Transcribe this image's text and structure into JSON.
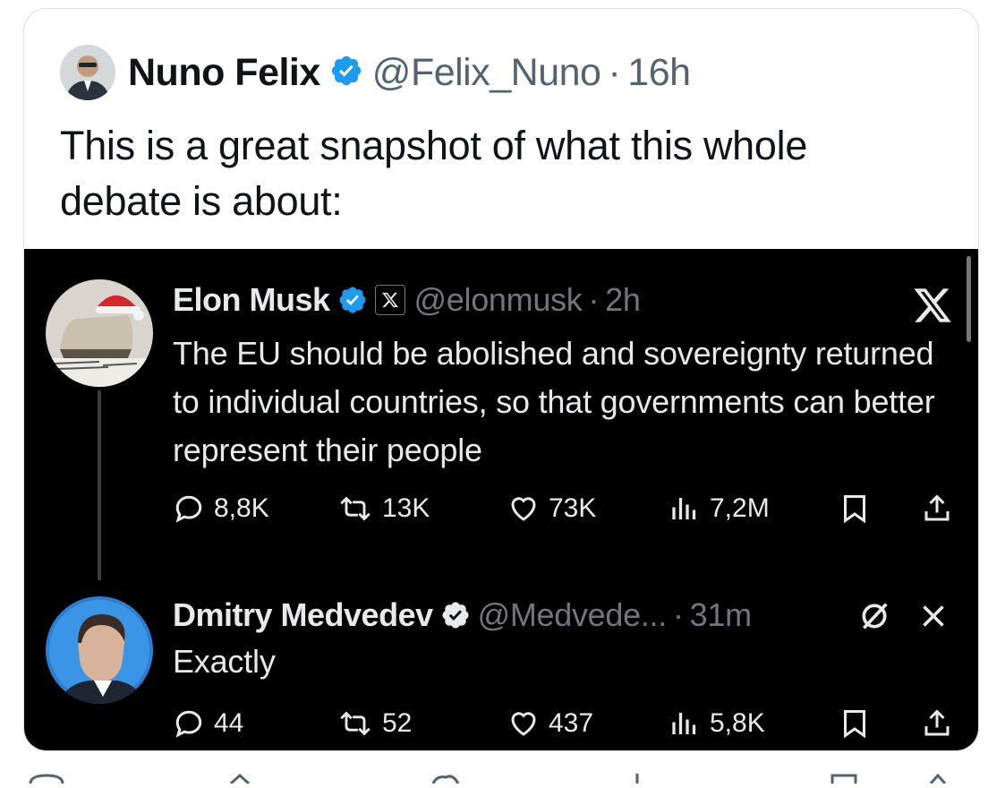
{
  "outer_tweet": {
    "author_name": "Nuno Felix",
    "handle": "@Felix_Nuno",
    "separator": "·",
    "time": "16h",
    "text": "This is a great snapshot of what this whole debate is about:"
  },
  "embedded": {
    "tweet1": {
      "author_name": "Elon Musk",
      "handle": "@elonmusk",
      "separator": "·",
      "time": "2h",
      "text": "The EU should be abolished and sovereignty returned to individual countries, so that governments can better represent their people",
      "replies": "8,8K",
      "reposts": "13K",
      "likes": "73K",
      "views": "7,2M"
    },
    "tweet2": {
      "author_name": "Dmitry Medvedev",
      "handle": "@Medvede...",
      "separator": "·",
      "time": "31m",
      "text": "Exactly",
      "replies": "44",
      "reposts": "52",
      "likes": "437",
      "views": "5,8K"
    }
  },
  "colors": {
    "verified_blue": "#1d9bf0",
    "muted_gray": "#71767b",
    "dark_background": "#000000"
  },
  "icons": [
    "verified-badge-icon",
    "x-logo-icon",
    "reply-icon",
    "repost-icon",
    "like-icon",
    "views-icon",
    "bookmark-icon",
    "share-icon",
    "mute-icon",
    "close-icon"
  ]
}
